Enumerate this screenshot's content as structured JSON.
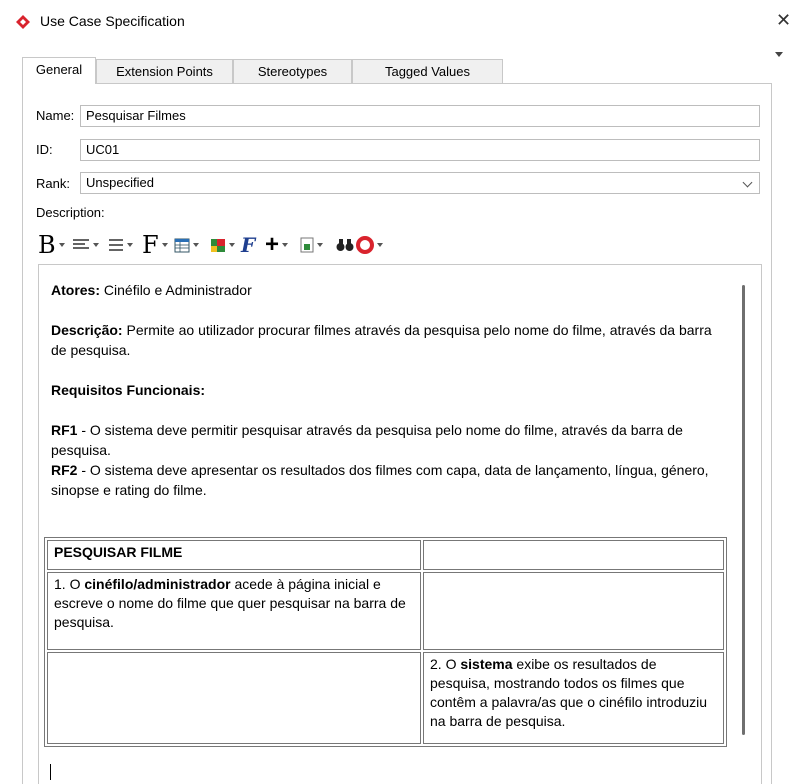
{
  "window": {
    "title": "Use Case Specification",
    "close_glyph": "✕"
  },
  "tabs": [
    {
      "label": "General"
    },
    {
      "label": "Extension Points"
    },
    {
      "label": "Stereotypes"
    },
    {
      "label": "Tagged Values"
    }
  ],
  "form": {
    "name_label": "Name:",
    "name_value": "Pesquisar Filmes",
    "id_label": "ID:",
    "id_value": "UC01",
    "rank_label": "Rank:",
    "rank_value": "Unspecified",
    "description_label": "Description:"
  },
  "toolbar_icons": [
    "bold-font-icon",
    "align-icon",
    "list-icon",
    "font-icon",
    "table-icon",
    "color-icon",
    "formula-icon",
    "insert-icon",
    "document-icon",
    "find-icon",
    "spellcheck-icon"
  ],
  "description": {
    "actors_label": "Atores:",
    "actors_text": " Cinéfilo e Administrador",
    "desc_label": "Descrição:",
    "desc_text": " Permite ao utilizador procurar filmes através da pesquisa pelo nome do filme, através da barra de pesquisa.",
    "req_heading": "Requisitos Funcionais:",
    "rf1_label": "RF1",
    "rf1_text": " - O sistema deve permitir pesquisar através da pesquisa pelo nome do filme, através da barra de pesquisa.",
    "rf2_label": "RF2",
    "rf2_text": " - O sistema deve apresentar os resultados dos filmes com capa, data de lançamento, língua, género, sinopse e rating do filme."
  },
  "table": {
    "header": "PESQUISAR FILME",
    "row1_pre": "1. O ",
    "row1_bold": "cinéfilo/administrador",
    "row1_post": " acede à página inicial e escreve o nome do filme que quer pesquisar na barra de pesquisa.",
    "row2_pre": "2. O ",
    "row2_bold": "sistema",
    "row2_post": " exibe os resultados de pesquisa, mostrando todos os filmes que contêm a palavra/as que o cinéfilo introduziu na barra de pesquisa."
  },
  "colors": {
    "accent_icon": "#d9232d",
    "border": "#c8c8c8"
  }
}
